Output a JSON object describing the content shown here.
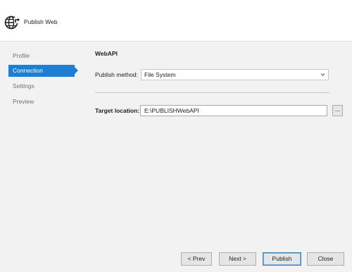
{
  "window": {
    "title": "Publish Web",
    "app_icon": "globe-publish-icon"
  },
  "sidebar": {
    "items": [
      {
        "label": "Profile",
        "active": false
      },
      {
        "label": "Connection",
        "active": true
      },
      {
        "label": "Settings",
        "active": false
      },
      {
        "label": "Preview",
        "active": false
      }
    ]
  },
  "main": {
    "section_title": "WebAPI",
    "publish_method": {
      "label": "Publish method:",
      "value": "File System"
    },
    "target_location": {
      "label": "Target location:",
      "value": "E:\\PUBLISHWebAPI",
      "browse_label": "..."
    }
  },
  "footer": {
    "prev_label": "< Prev",
    "next_label": "Next >",
    "publish_label": "Publish",
    "close_label": "Close"
  },
  "colors": {
    "accent": "#1c7fd4",
    "background": "#f2f2f2",
    "header": "#ffffff"
  }
}
